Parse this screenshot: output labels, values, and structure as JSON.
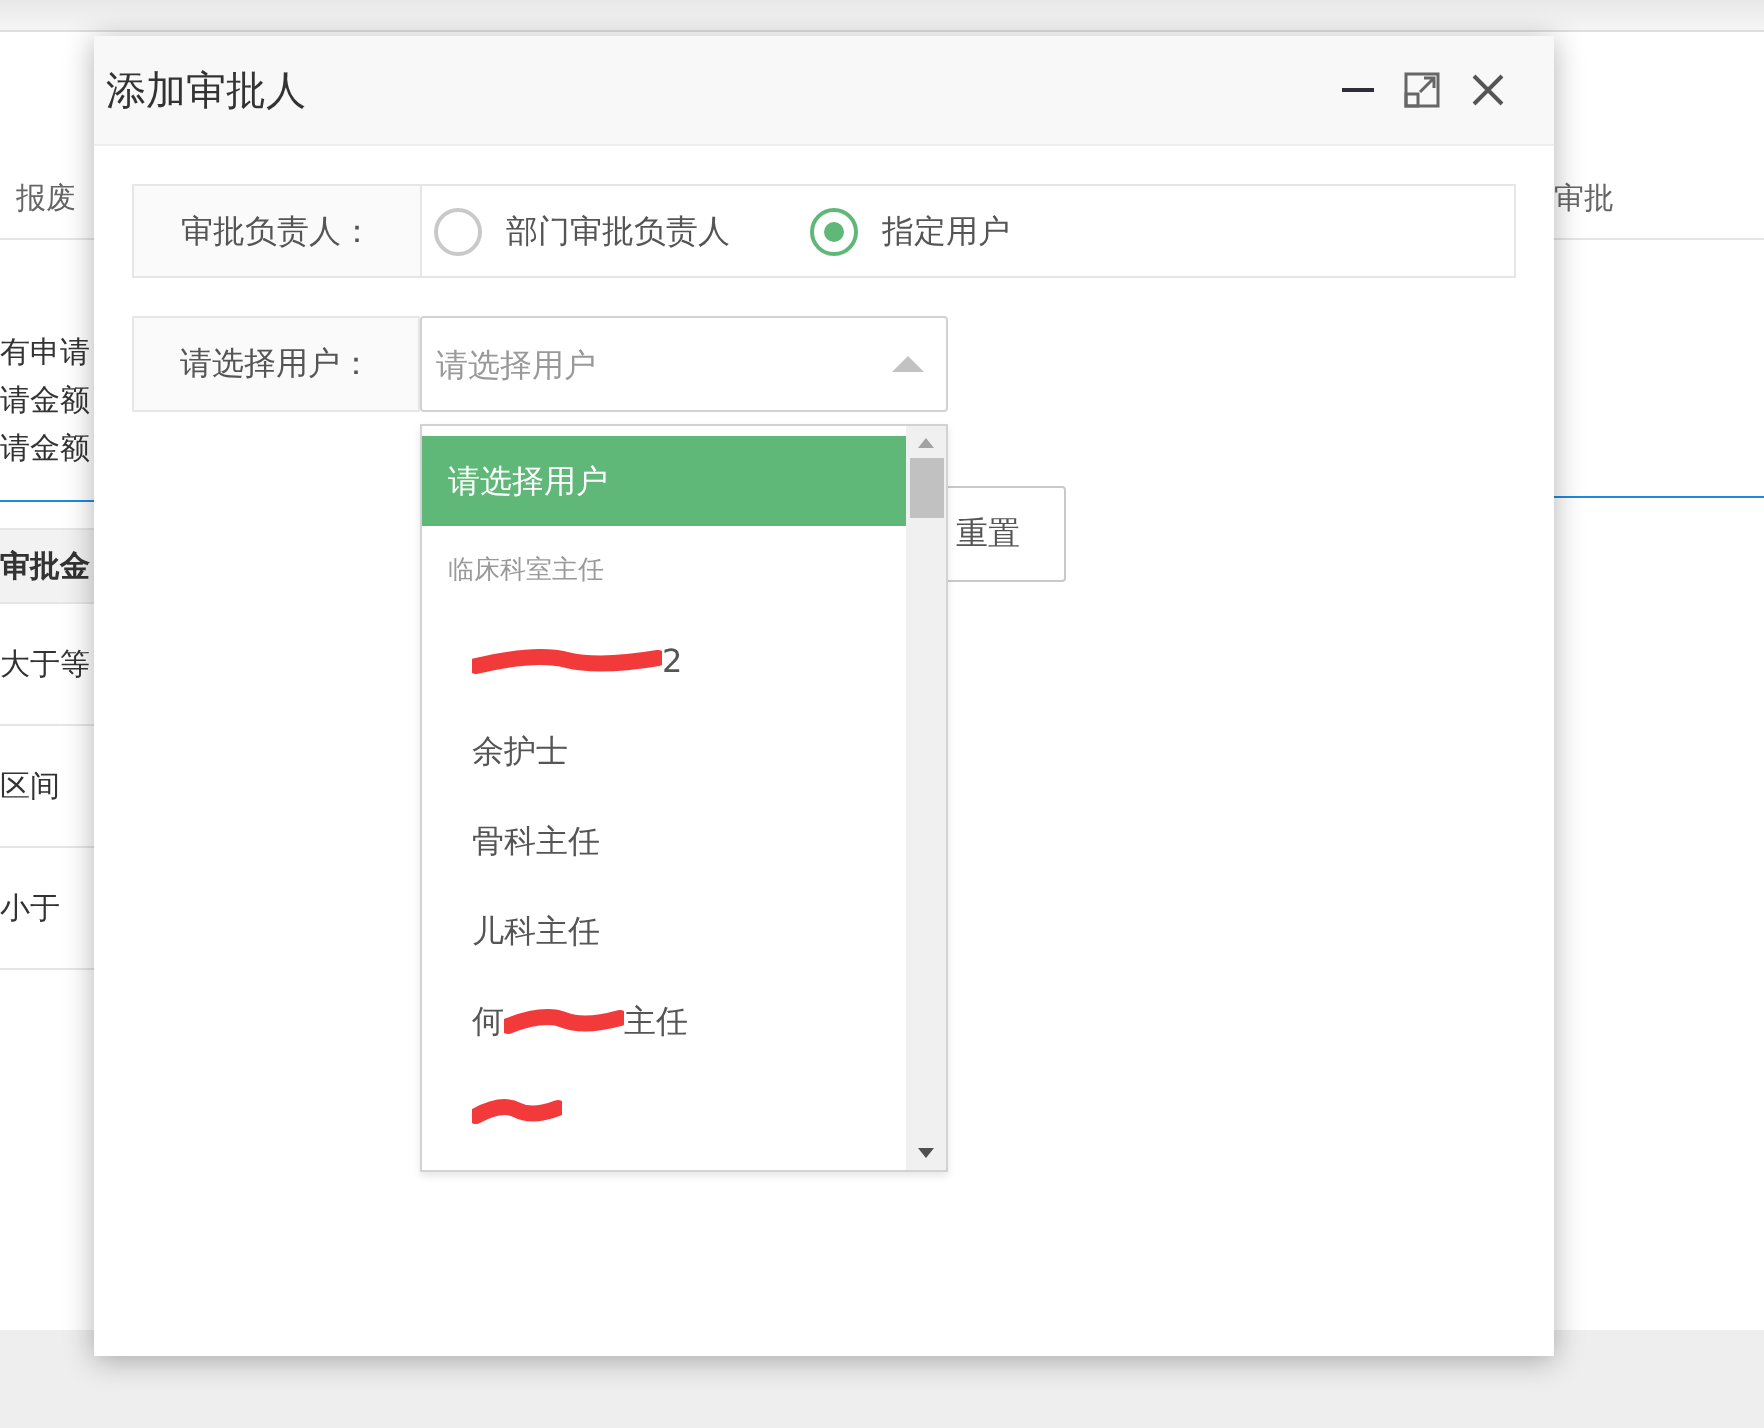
{
  "background": {
    "left_texts": [
      {
        "text": "报废",
        "kind": "tab"
      },
      {
        "text": "有申请",
        "kind": "line"
      },
      {
        "text": "请金额",
        "kind": "line"
      },
      {
        "text": "请金额",
        "kind": "line"
      },
      {
        "text": "审批金",
        "kind": "header"
      },
      {
        "text": "大于等",
        "kind": "row"
      },
      {
        "text": "区间",
        "kind": "row"
      },
      {
        "text": "小于",
        "kind": "row"
      }
    ],
    "right_tab": "审批"
  },
  "dialog": {
    "title": "添加审批人",
    "approver_label": "审批负责人：",
    "approver_options": [
      {
        "label": "部门审批负责人",
        "selected": false
      },
      {
        "label": "指定用户",
        "selected": true
      }
    ],
    "user_label": "请选择用户：",
    "user_select": {
      "placeholder": "请选择用户",
      "expanded": true
    },
    "reset_button": "重置",
    "dropdown": [
      {
        "kind": "option",
        "text": "请选择用户",
        "selected": true
      },
      {
        "kind": "group",
        "text": "临床科室主任"
      },
      {
        "kind": "option",
        "text": "2",
        "redacted": true,
        "selected": false
      },
      {
        "kind": "option",
        "text": "余护士",
        "selected": false
      },
      {
        "kind": "option",
        "text": "骨科主任",
        "selected": false
      },
      {
        "kind": "option",
        "text": "儿科主任",
        "selected": false
      },
      {
        "kind": "option",
        "prefix": "何",
        "text": "主任",
        "redacted": true,
        "selected": false
      },
      {
        "kind": "option",
        "redacted": true,
        "selected": false
      }
    ]
  }
}
